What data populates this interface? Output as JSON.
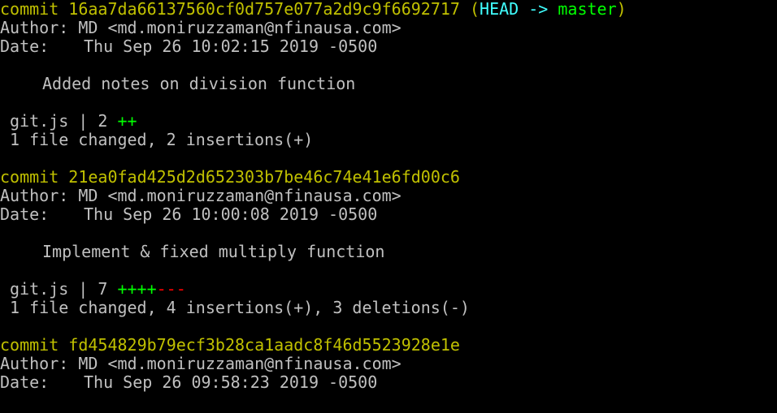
{
  "colors": {
    "background": "#000000",
    "text": "#c0c0c0",
    "commit_hash": "#c0c000",
    "head_ref": "#40ffff",
    "branch": "#00ff00",
    "insertions": "#00ff00",
    "deletions": "#ff0000"
  },
  "commits": [
    {
      "keyword": "commit",
      "hash": "16aa7da66137560cf0d757e077a2d9c9f6692717",
      "refs_open": "(",
      "refs_head": "HEAD ->",
      "refs_branch": "master",
      "refs_close": ")",
      "author_label": "Author:",
      "author": "MD <md.moniruzzaman@nfinausa.com>",
      "date_label": "Date:",
      "date": "Thu Sep 26 10:02:15 2019 -0500",
      "message": "Added notes on division function",
      "stat_file": "git.js | 2",
      "stat_plus": "++",
      "stat_minus": "",
      "summary": "1 file changed, 2 insertions(+)"
    },
    {
      "keyword": "commit",
      "hash": "21ea0fad425d2d652303b7be46c74e41e6fd00c6",
      "author_label": "Author:",
      "author": "MD <md.moniruzzaman@nfinausa.com>",
      "date_label": "Date:",
      "date": "Thu Sep 26 10:00:08 2019 -0500",
      "message": "Implement & fixed multiply function",
      "stat_file": "git.js | 7",
      "stat_plus": "++++",
      "stat_minus": "---",
      "summary": "1 file changed, 4 insertions(+), 3 deletions(-)"
    },
    {
      "keyword": "commit",
      "hash": "fd454829b79ecf3b28ca1aadc8f46d5523928e1e",
      "author_label": "Author:",
      "author": "MD <md.moniruzzaman@nfinausa.com>",
      "date_label": "Date:",
      "date": "Thu Sep 26 09:58:23 2019 -0500"
    }
  ]
}
